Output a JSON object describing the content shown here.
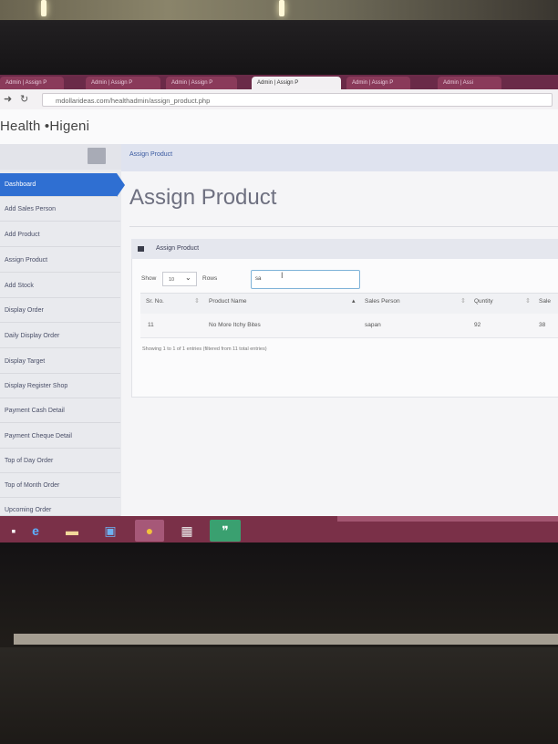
{
  "browser": {
    "tabs": [
      "Admin | Assign P",
      "Admin | Assign P",
      "Admin | Assign P",
      "Admin | Assign P",
      "Admin | Assign P",
      "Admin | Assi"
    ],
    "active_tab_label": "Admin | Assign P",
    "url": "mdollarideas.com/healthadmin/assign_product.php"
  },
  "app": {
    "brand": "Health •Higeni"
  },
  "sidebar": {
    "items": [
      {
        "label": "Dashboard"
      },
      {
        "label": "Add Sales Person"
      },
      {
        "label": "Add Product"
      },
      {
        "label": "Assign Product"
      },
      {
        "label": "Add Stock"
      },
      {
        "label": "Display Order"
      },
      {
        "label": "Daily Display Order"
      },
      {
        "label": "Display Target"
      },
      {
        "label": "Display Register Shop"
      },
      {
        "label": "Payment Cash Detail"
      },
      {
        "label": "Payment Cheque Detail"
      },
      {
        "label": "Top of Day Order"
      },
      {
        "label": "Top of Month Order"
      },
      {
        "label": "Upcoming Order"
      }
    ]
  },
  "breadcrumb": "Assign Product",
  "page_title": "Assign Product",
  "panel": {
    "title": "Assign Product",
    "show_label": "Show",
    "rows_label": "Rows",
    "page_size": "10",
    "search_value": "sa",
    "columns": [
      "Sr. No.",
      "Product Name",
      "Sales Person",
      "Quntity",
      "Sale"
    ],
    "rows": [
      {
        "sr": "11",
        "product": "No More Itchy Bites",
        "person": "sapan",
        "qty": "92",
        "sale": "38"
      }
    ],
    "info": "Showing 1 to 1 of 1 entries (filtered from 11 total entries)"
  },
  "taskbar": {
    "icons": [
      "ie-icon",
      "folder-icon",
      "monitor-icon",
      "chrome-icon",
      "calculator-icon",
      "quote-app-icon"
    ]
  }
}
